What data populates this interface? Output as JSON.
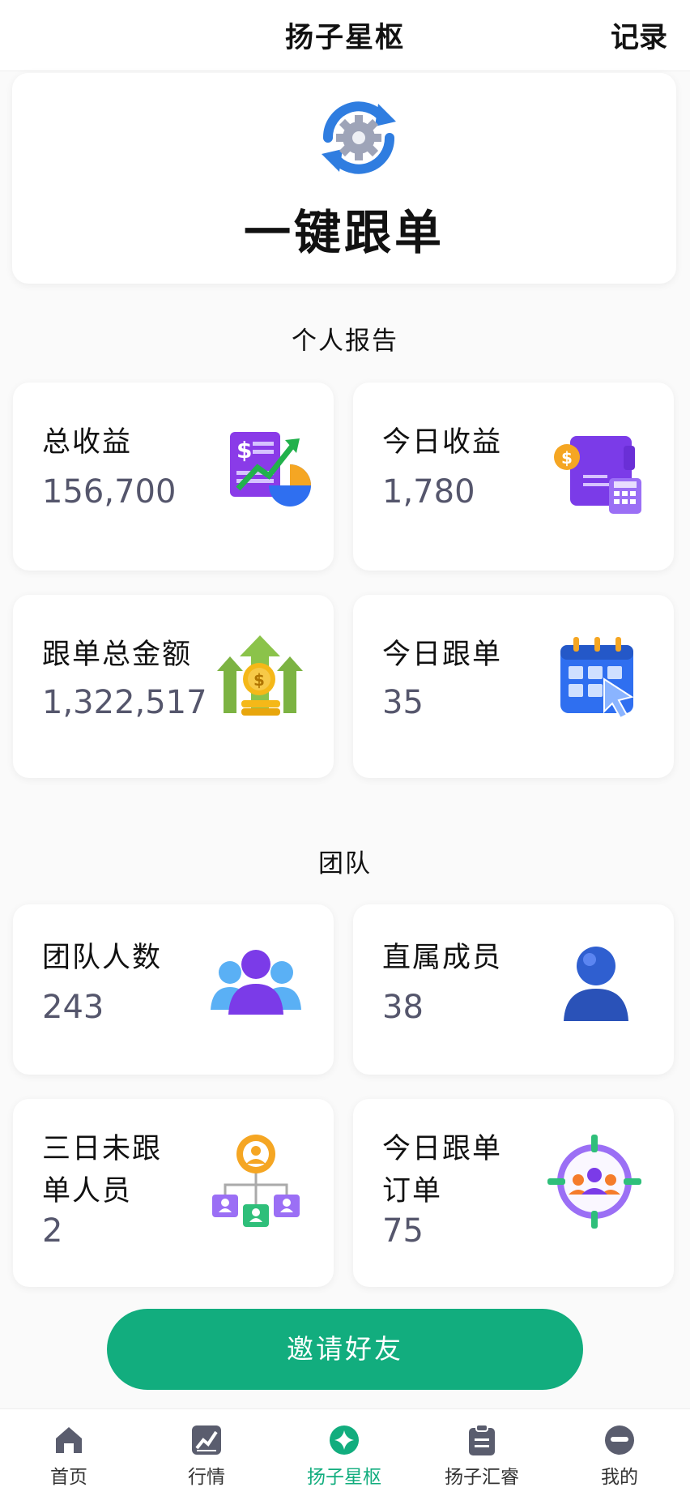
{
  "header": {
    "title": "扬子星枢",
    "record": "记录"
  },
  "hero": {
    "label": "一键跟单",
    "icon": "sync-gear-icon"
  },
  "personal": {
    "title": "个人报告",
    "cards": [
      {
        "name": "总收益",
        "value": "156,700",
        "icon": "revenue-chart-icon"
      },
      {
        "name": "今日收益",
        "value": "1,780",
        "icon": "wallet-calculator-icon"
      },
      {
        "name": "跟单总金额",
        "value": "1,322,517",
        "icon": "coin-growth-icon"
      },
      {
        "name": "今日跟单",
        "value": "35",
        "icon": "calendar-click-icon"
      }
    ]
  },
  "team": {
    "title": "团队",
    "cards": [
      {
        "name": "团队人数",
        "value": "243",
        "icon": "team-group-icon"
      },
      {
        "name": "直属成员",
        "value": "38",
        "icon": "member-person-icon"
      },
      {
        "name": "三日未跟单人员",
        "value": "2",
        "icon": "org-chart-icon"
      },
      {
        "name": "今日跟单订单",
        "value": "75",
        "icon": "target-team-icon"
      }
    ]
  },
  "invite": {
    "label": "邀请好友"
  },
  "tabs": [
    {
      "label": "首页",
      "icon": "home-icon"
    },
    {
      "label": "行情",
      "icon": "market-chart-icon"
    },
    {
      "label": "扬子星枢",
      "icon": "star-hub-icon",
      "active": true
    },
    {
      "label": "扬子汇睿",
      "icon": "clipboard-icon"
    },
    {
      "label": "我的",
      "icon": "profile-icon"
    }
  ],
  "colors": {
    "accent": "#12ad7e",
    "value_text": "#55566c"
  }
}
